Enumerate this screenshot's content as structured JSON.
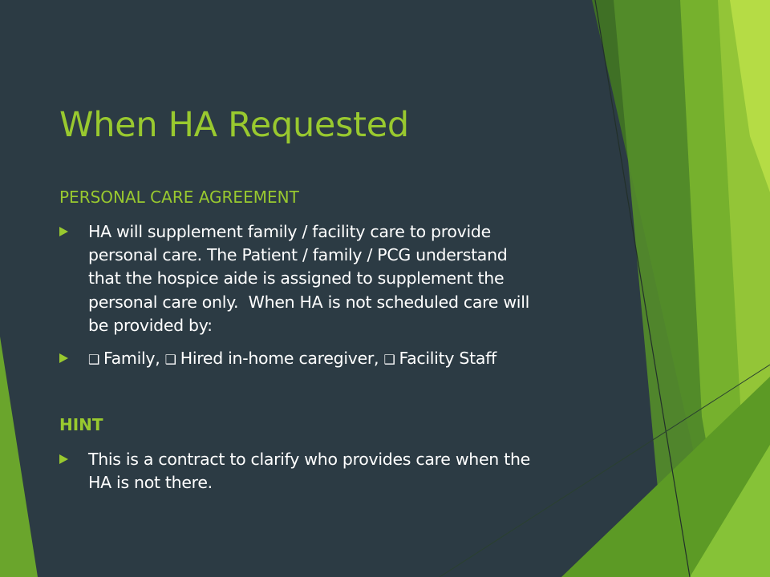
{
  "slide": {
    "title": "When HA Requested",
    "section1": {
      "heading": "PERSONAL CARE AGREEMENT",
      "bullets": [
        {
          "lines": [
            "HA will supplement family / facility care to provide",
            "personal care. The Patient / family / PCG understand",
            "that the hospice aide is assigned to supplement the",
            "personal care only.  When HA is not scheduled care will",
            "be provided by:"
          ]
        }
      ],
      "checkbox_options": [
        {
          "label": "Family,",
          "checked": false
        },
        {
          "label": "Hired in-home caregiver,",
          "checked": false
        },
        {
          "label": "Facility Staff",
          "checked": false
        }
      ]
    },
    "section2": {
      "heading": "HINT",
      "bullets": [
        {
          "lines": [
            "This is a contract to clarify who provides care when the",
            "HA is not there."
          ]
        }
      ]
    },
    "colors": {
      "background": "#2c3b44",
      "accent": "#99c92f",
      "text": "#ffffff",
      "deco_dark": "#3f7025",
      "deco_mid": "#5e9b26",
      "deco_light": "#9ccd3b"
    },
    "icons": {
      "bullet": "triangle-arrow-right",
      "checkbox": "empty-checkbox"
    }
  }
}
